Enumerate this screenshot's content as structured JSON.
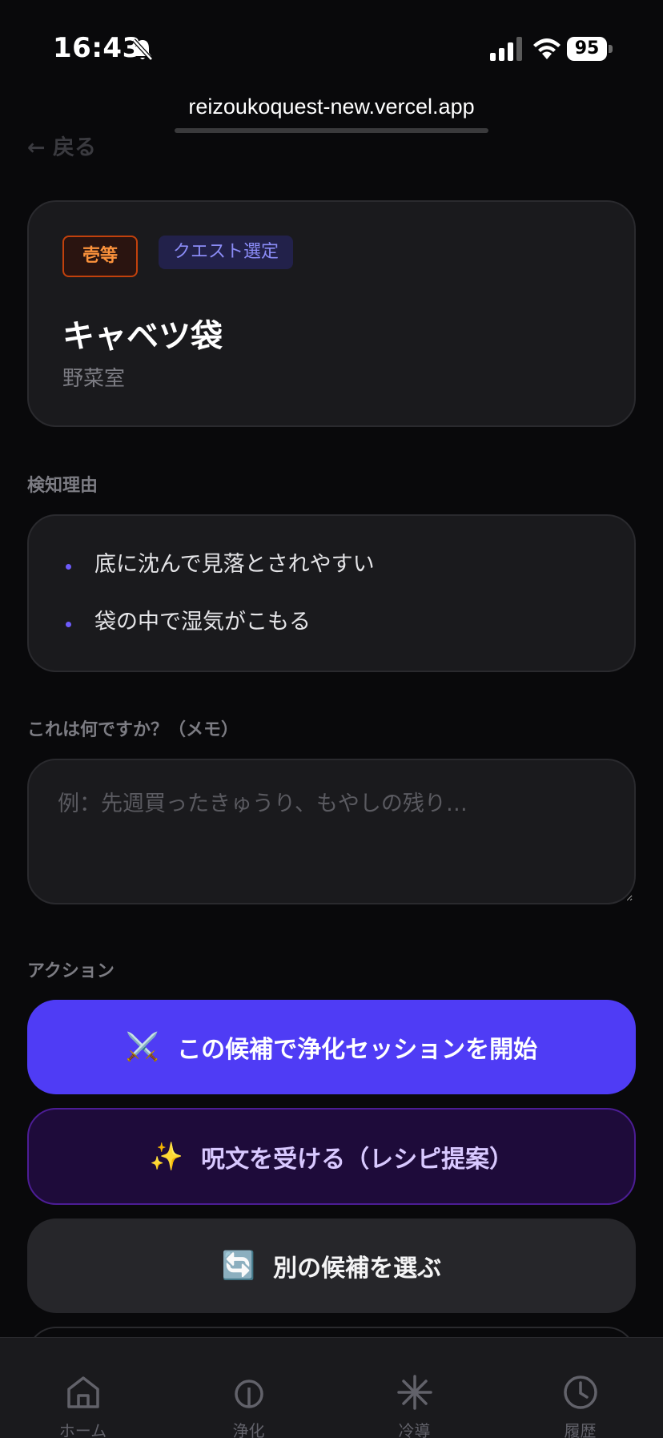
{
  "status_bar": {
    "time": "16:43",
    "battery": "95"
  },
  "browser": {
    "url": "reizoukoquest-new.vercel.app"
  },
  "nav": {
    "back_label": "← 戻る"
  },
  "item": {
    "rank": "壱等",
    "status": "クエスト選定",
    "name": "キャベツ袋",
    "location": "野菜室"
  },
  "detection": {
    "label": "検知理由",
    "reasons": [
      "底に沈んで見落とされやすい",
      "袋の中で湿気がこもる"
    ]
  },
  "memo": {
    "label": "これは何ですか？（メモ）",
    "value": "",
    "placeholder": "例：先週買ったきゅうり、もやしの残り…"
  },
  "actions": {
    "label": "アクション",
    "start": {
      "icon": "⚔️",
      "label": "この候補で浄化セッションを開始"
    },
    "spell": {
      "icon": "✨",
      "label": "呪文を受ける（レシピ提案）"
    },
    "alternate": {
      "icon": "🔄",
      "label": "別の候補を選ぶ"
    }
  },
  "tabs": [
    {
      "icon": "home-icon",
      "label": "ホーム"
    },
    {
      "icon": "purify-icon",
      "label": "浄化"
    },
    {
      "icon": "freeze-icon",
      "label": "冷導"
    },
    {
      "icon": "history-icon",
      "label": "履歴"
    }
  ],
  "colors": {
    "primary": "#4f3cf5",
    "rank": "#fb923c",
    "status": "#8b8cf7",
    "background": "#09090b",
    "card": "#1a1a1d"
  }
}
